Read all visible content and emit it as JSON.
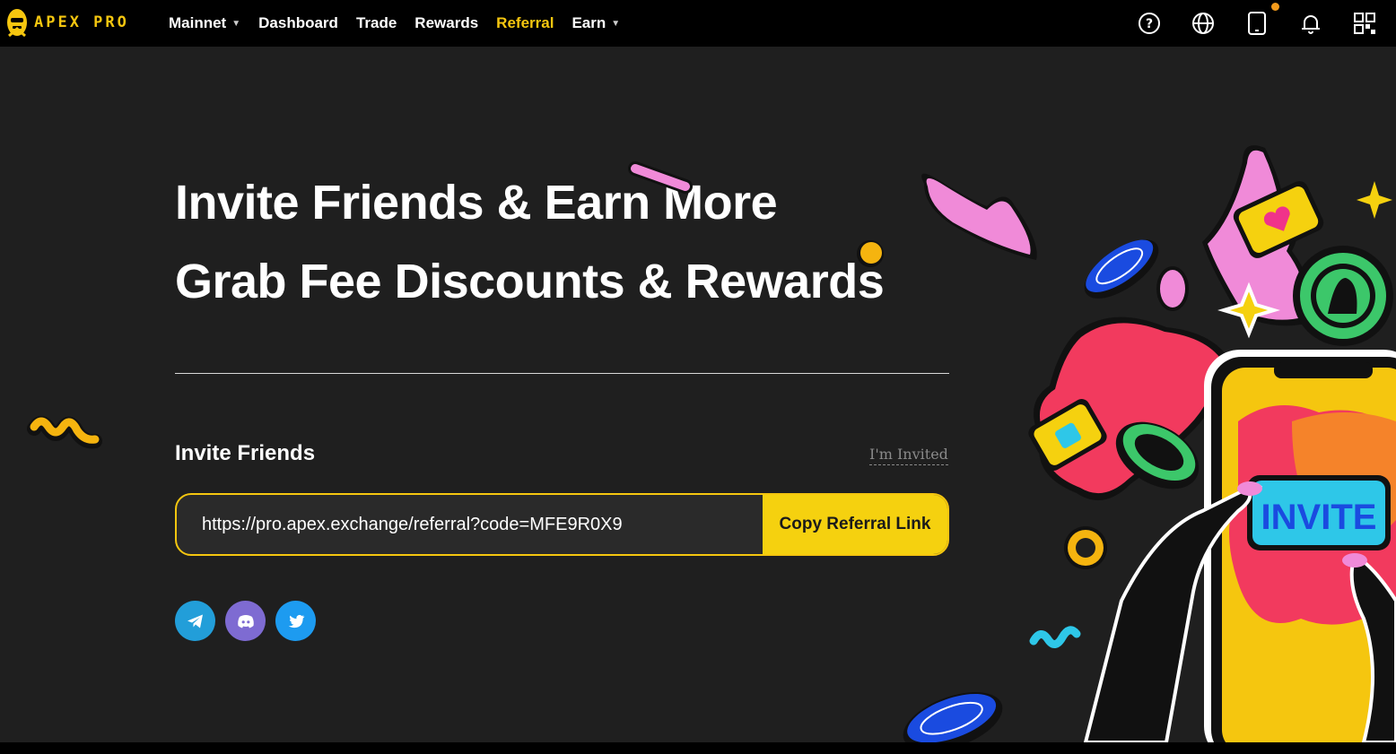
{
  "brand": {
    "name": "APEX PRO",
    "color": "#f5c60f"
  },
  "nav": {
    "network": "Mainnet",
    "items": [
      {
        "label": "Dashboard",
        "active": false
      },
      {
        "label": "Trade",
        "active": false
      },
      {
        "label": "Rewards",
        "active": false
      },
      {
        "label": "Referral",
        "active": true
      },
      {
        "label": "Earn",
        "active": false,
        "dropdown": true
      }
    ],
    "icons": [
      "help-icon",
      "globe-icon",
      "mobile-icon",
      "bell-icon",
      "qr-code-icon"
    ]
  },
  "hero": {
    "line1": "Invite Friends & Earn More",
    "line2": "Grab Fee Discounts & Rewards"
  },
  "invite": {
    "label": "Invite Friends",
    "invited_link": "I'm Invited",
    "referral_url": "https://pro.apex.exchange/referral?code=MFE9R0X9",
    "copy_button": "Copy Referral Link"
  },
  "illustration": {
    "phone_button": "INVITE"
  },
  "socials": [
    "telegram-icon",
    "discord-icon",
    "twitter-icon"
  ],
  "colors": {
    "accent": "#f5c60f",
    "background": "#1f1f1f",
    "topbar": "#000000"
  }
}
